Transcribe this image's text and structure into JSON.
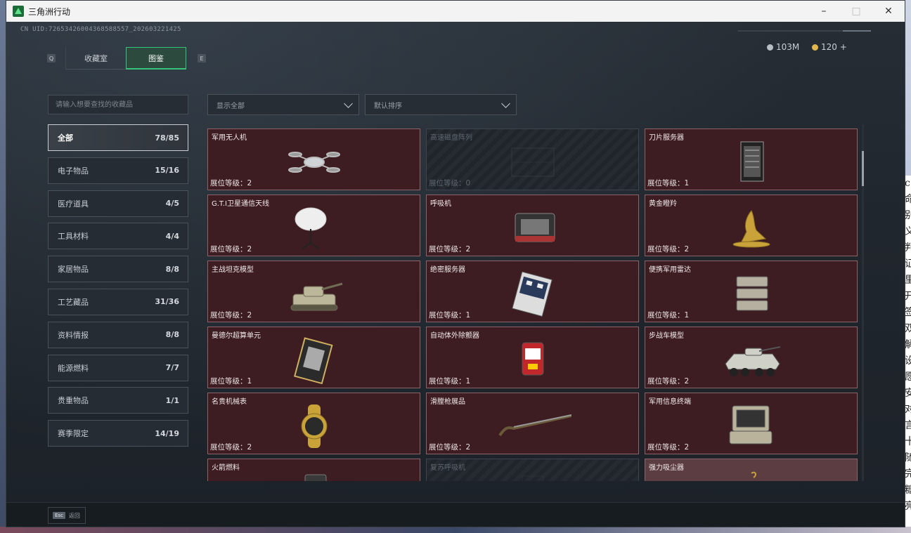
{
  "window": {
    "title": "三角洲行动"
  },
  "header": {
    "uid": "CN UID:7265342600436858855​7_202603221425",
    "tab_left_key": "Q",
    "tab_right_key": "E",
    "tabs": [
      {
        "label": "收藏室",
        "active": false
      },
      {
        "label": "图鉴",
        "active": true
      }
    ],
    "currency": [
      {
        "value": "103M",
        "color": "#b9bec4"
      },
      {
        "value": "120 +",
        "color": "#e0b84a"
      }
    ]
  },
  "search": {
    "placeholder": "请输入想要查找的收藏品"
  },
  "filters": {
    "show": "显示全部",
    "sort": "默认排序"
  },
  "categories": [
    {
      "name": "全部",
      "count": "78/85",
      "active": true
    },
    {
      "name": "电子物品",
      "count": "15/16"
    },
    {
      "name": "医疗道具",
      "count": "4/5"
    },
    {
      "name": "工具材料",
      "count": "4/4"
    },
    {
      "name": "家居物品",
      "count": "8/8"
    },
    {
      "name": "工艺藏品",
      "count": "31/36"
    },
    {
      "name": "资料情报",
      "count": "8/8"
    },
    {
      "name": "能源燃料",
      "count": "7/7"
    },
    {
      "name": "贵重物品",
      "count": "1/1"
    },
    {
      "name": "赛季限定",
      "count": "14/19"
    }
  ],
  "items": [
    {
      "name": "军用无人机",
      "level": "展位等级：2",
      "icon": "drone-icon",
      "locked": false
    },
    {
      "name": "高速磁盘阵列",
      "level": "展位等级：0",
      "icon": "disk-array-icon",
      "locked": true
    },
    {
      "name": "刀片服务器",
      "level": "展位等级：1",
      "icon": "server-icon",
      "locked": false
    },
    {
      "name": "G.T.I卫星通信天线",
      "level": "展位等级：2",
      "icon": "satellite-dish-icon",
      "locked": false
    },
    {
      "name": "呼吸机",
      "level": "展位等级：2",
      "icon": "ventilator-icon",
      "locked": false
    },
    {
      "name": "黄金瞪羚",
      "level": "展位等级：2",
      "icon": "golden-gazelle-icon",
      "locked": false
    },
    {
      "name": "主战坦克模型",
      "level": "展位等级：2",
      "icon": "tank-icon",
      "locked": false
    },
    {
      "name": "绝密服务器",
      "level": "展位等级：1",
      "icon": "secret-server-icon",
      "locked": false
    },
    {
      "name": "便携军用雷达",
      "level": "展位等级：1",
      "icon": "radar-icon",
      "locked": false
    },
    {
      "name": "曼德尔超算单元",
      "level": "展位等级：1",
      "icon": "supercomputer-icon",
      "locked": false
    },
    {
      "name": "自动体外除颤器",
      "level": "展位等级：1",
      "icon": "defibrillator-icon",
      "locked": false
    },
    {
      "name": "步战车模型",
      "level": "展位等级：2",
      "icon": "ifv-icon",
      "locked": false
    },
    {
      "name": "名贵机械表",
      "level": "展位等级：2",
      "icon": "watch-icon",
      "locked": false
    },
    {
      "name": "滑膛枪展品",
      "level": "展位等级：2",
      "icon": "musket-icon",
      "locked": false
    },
    {
      "name": "军用信息终端",
      "level": "展位等级：2",
      "icon": "terminal-icon",
      "locked": false
    },
    {
      "name": "火箭燃料",
      "level": "",
      "icon": "fuel-can-icon",
      "locked": false
    },
    {
      "name": "复苏呼吸机",
      "level": "",
      "icon": "resuscitator-icon",
      "locked": true
    },
    {
      "name": "强力吸尘器",
      "level": "",
      "icon": "vacuum-icon",
      "locked": false,
      "light": true
    }
  ],
  "footer": {
    "esc_key": "Esc",
    "esc_label": "返回"
  },
  "desktop_doc_chars": [
    "c",
    "命",
    "别",
    "义",
    "",
    "判",
    "证",
    "里",
    "开",
    "签",
    "双",
    "解",
    "设",
    "愿",
    "安",
    "对",
    "言",
    "十",
    "随",
    "完",
    "糖亮"
  ]
}
